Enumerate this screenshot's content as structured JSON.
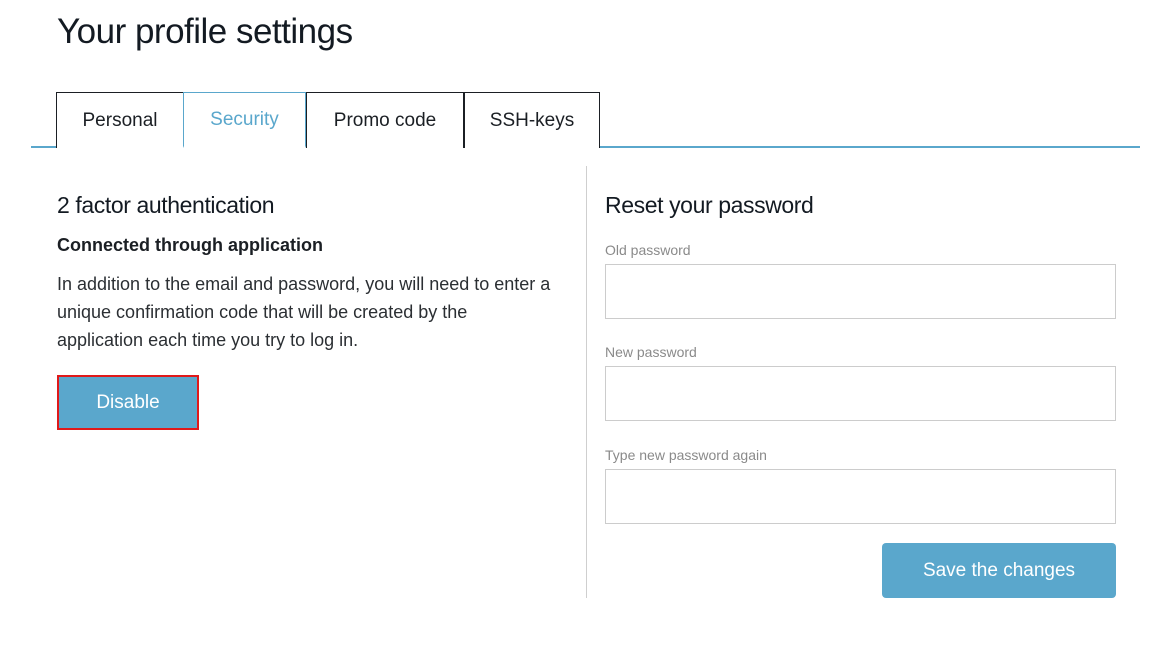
{
  "page": {
    "title": "Your profile settings"
  },
  "tabs": [
    {
      "label": "Personal",
      "active": false
    },
    {
      "label": "Security",
      "active": true
    },
    {
      "label": "Promo code",
      "active": false
    },
    {
      "label": "SSH-keys",
      "active": false
    }
  ],
  "two_factor": {
    "title": "2 factor authentication",
    "status": "Connected through application",
    "description": "In addition to the email and password, you will need to enter a unique confirmation code that will be created by the application each time you try to log in.",
    "disable_label": "Disable"
  },
  "reset_password": {
    "title": "Reset your password",
    "fields": [
      {
        "label": "Old password",
        "value": "",
        "placeholder": ""
      },
      {
        "label": "New password",
        "value": "",
        "placeholder": ""
      },
      {
        "label": "Type new password again",
        "value": "",
        "placeholder": ""
      }
    ],
    "save_label": "Save the changes"
  },
  "colors": {
    "accent": "#5aa7cc",
    "highlight_border": "#e0191a",
    "text": "#1b1f24",
    "label": "#8a8a8a"
  }
}
